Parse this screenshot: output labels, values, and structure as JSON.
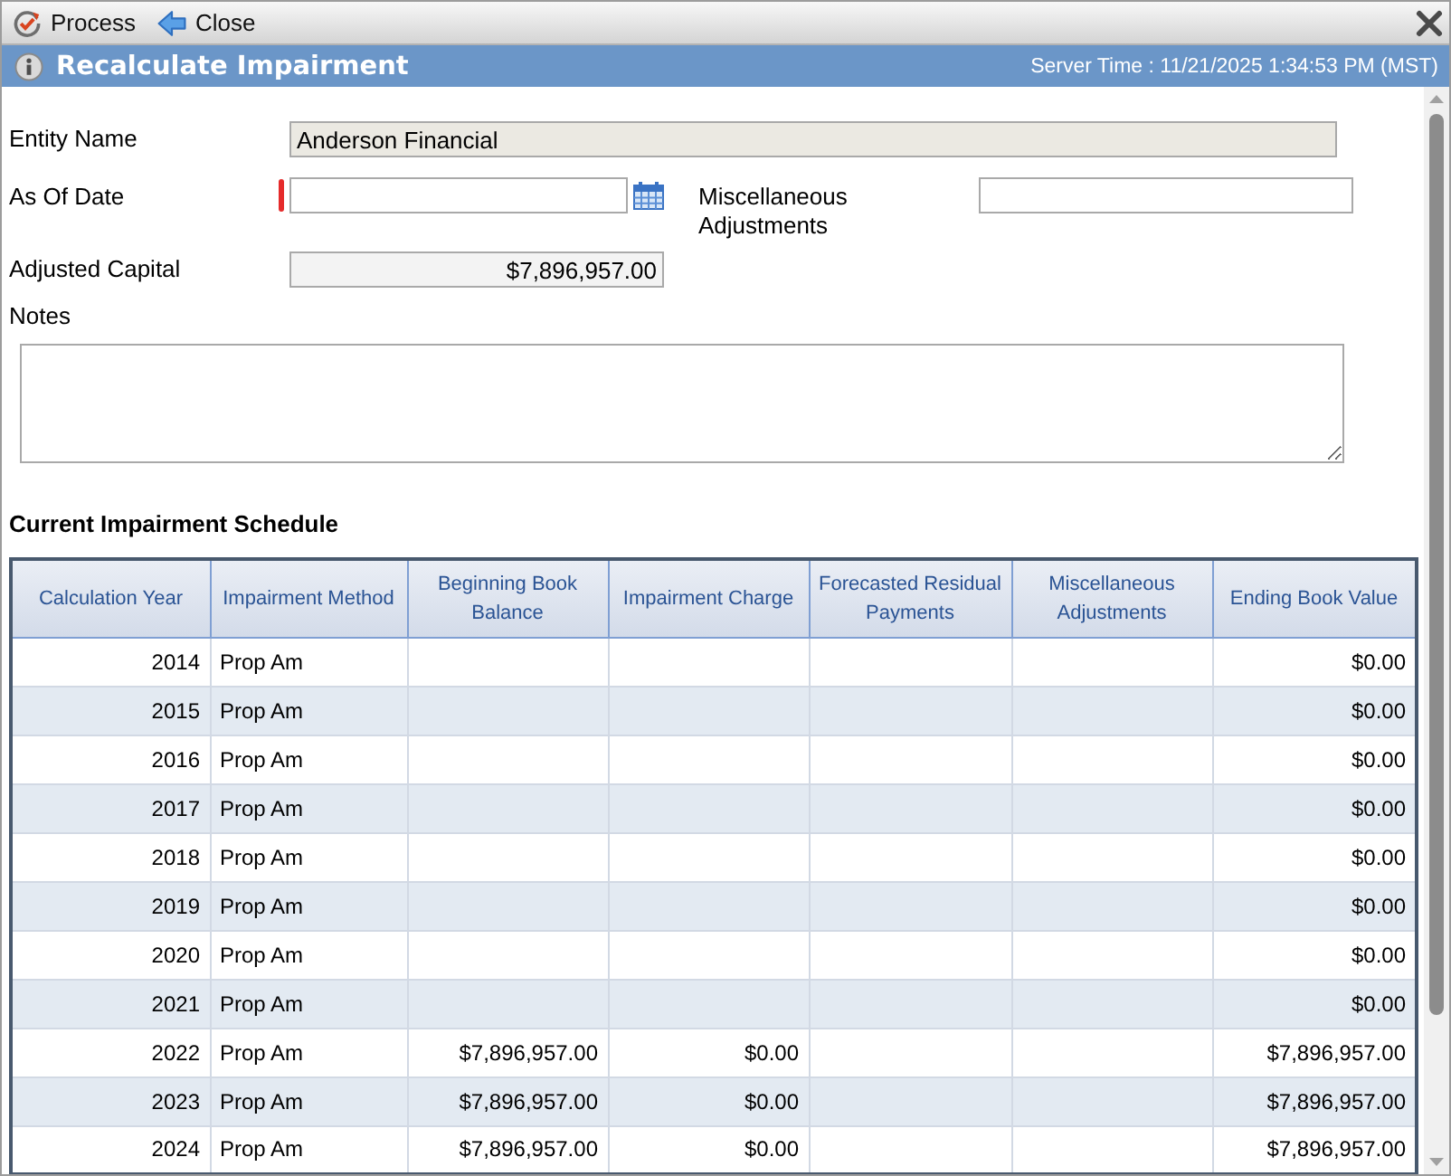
{
  "toolbar": {
    "buttons": [
      {
        "kind": "process",
        "label": "Process"
      },
      {
        "kind": "close",
        "label": "Close"
      }
    ]
  },
  "title_bar": {
    "title": "Recalculate Impairment",
    "server_time": "Server Time : 11/21/2025 1:34:53 PM (MST)"
  },
  "form": {
    "entity_name": {
      "label": "Entity Name",
      "value": "Anderson Financial",
      "readonly": true
    },
    "as_of_date": {
      "label": "As Of Date",
      "required": true,
      "readonly": false
    },
    "misc_adjustments": {
      "label": "Miscellaneous Adjustments",
      "readonly": false
    },
    "adjusted_capital": {
      "label": "Adjusted Capital",
      "value": "$7,896,957.00",
      "readonly": true
    },
    "notes": {
      "label": "Notes"
    }
  },
  "schedule": {
    "title": "Current Impairment Schedule",
    "columns": [
      "Calculation Year",
      "Impairment Method",
      "Beginning Book Balance",
      "Impairment Charge",
      "Forecasted Residual Payments",
      "Miscellaneous Adjustments",
      "Ending Book Value"
    ],
    "rows": [
      {
        "year": "2014",
        "method": "Prop Am",
        "ending_value": "$0.00"
      },
      {
        "year": "2015",
        "method": "Prop Am",
        "ending_value": "$0.00"
      },
      {
        "year": "2016",
        "method": "Prop Am",
        "ending_value": "$0.00"
      },
      {
        "year": "2017",
        "method": "Prop Am",
        "ending_value": "$0.00"
      },
      {
        "year": "2018",
        "method": "Prop Am",
        "ending_value": "$0.00"
      },
      {
        "year": "2019",
        "method": "Prop Am",
        "ending_value": "$0.00"
      },
      {
        "year": "2020",
        "method": "Prop Am",
        "ending_value": "$0.00"
      },
      {
        "year": "2021",
        "method": "Prop Am",
        "ending_value": "$0.00"
      },
      {
        "year": "2022",
        "method": "Prop Am",
        "beginning_balance": "$7,896,957.00",
        "impairment_charge": "$0.00",
        "ending_value": "$7,896,957.00"
      },
      {
        "year": "2023",
        "method": "Prop Am",
        "beginning_balance": "$7,896,957.00",
        "impairment_charge": "$0.00",
        "ending_value": "$7,896,957.00"
      },
      {
        "year": "2024",
        "method": "Prop Am",
        "beginning_balance": "$7,896,957.00",
        "impairment_charge": "$0.00",
        "ending_value": "$7,896,957.00"
      }
    ]
  }
}
